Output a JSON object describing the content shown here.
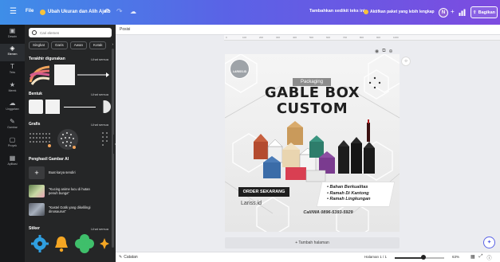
{
  "topbar": {
    "menu_icon": "hamburger-icon",
    "file_label": "File",
    "resize_label": "Ubah Ukuran dan Alih Ajaib",
    "undo_icon": "undo-icon",
    "redo_icon": "redo-icon",
    "cloud_icon": "cloud-icon",
    "add_name_label": "Tambahkan sedikit teks ini",
    "activate_label": "Aktifkan paket yang lebih lengkap",
    "avatar_initial": "N",
    "share_label": "Bagikan",
    "gradient_start": "#3e8ee8",
    "gradient_end": "#7d4be0"
  },
  "rail": {
    "items": [
      {
        "icon": "template-icon",
        "label": "Desain"
      },
      {
        "icon": "elements-icon",
        "label": "Elemen"
      },
      {
        "icon": "text-icon",
        "label": "Teks"
      },
      {
        "icon": "brand-icon",
        "label": "Merek"
      },
      {
        "icon": "upload-icon",
        "label": "Unggahan"
      },
      {
        "icon": "draw-icon",
        "label": "Gambar"
      },
      {
        "icon": "projects-icon",
        "label": "Proyek"
      },
      {
        "icon": "apps-icon",
        "label": "Aplikasi"
      }
    ],
    "active_index": 1
  },
  "panel": {
    "search_placeholder": "Cari elemen",
    "chips": [
      "Singkat",
      "Garis",
      "Awan",
      "Kotak"
    ],
    "chips_next_icon": "chevron-right-icon",
    "see_all": "Lihat semua",
    "sections": {
      "recent": "Terakhir digunakan",
      "shapes": "Bentuk",
      "graphics": "Grafis",
      "ai": "Penghasil Gambar AI",
      "stickers": "Stiker"
    },
    "ai_items": [
      {
        "text": "Buat karya sendiri"
      },
      {
        "text": "\"Kucing anime lucu di hutan penuh bunga\""
      },
      {
        "text": "\"Kastel Gotik yang dikelilingi dinosaurus\""
      }
    ]
  },
  "workspace": {
    "position_label": "Posisi",
    "ruler_marks": [
      "0",
      "100",
      "200",
      "300",
      "400",
      "500",
      "600",
      "700",
      "800",
      "900",
      "1000"
    ],
    "add_page_label": "+ Tambah halaman",
    "help_icon": "magic-icon"
  },
  "design": {
    "logo_text": "LARISS.ID",
    "tag": "Packaging",
    "title_line1": "GABLE BOX",
    "title_line2": "CUSTOM",
    "order_button": "ORDER SEKARANG",
    "website": "Lariss.id",
    "features": [
      "Bahan Berkualitas",
      "Ramah Di Kantong",
      "Ramah Lingkungan"
    ],
    "contact": "Call/WA 0896-5393-5929"
  },
  "bottombar": {
    "notes_label": "Catatan",
    "page_info": "Halaman 1 / 1",
    "zoom_value": "63%",
    "zoom_fraction": 0.58
  }
}
